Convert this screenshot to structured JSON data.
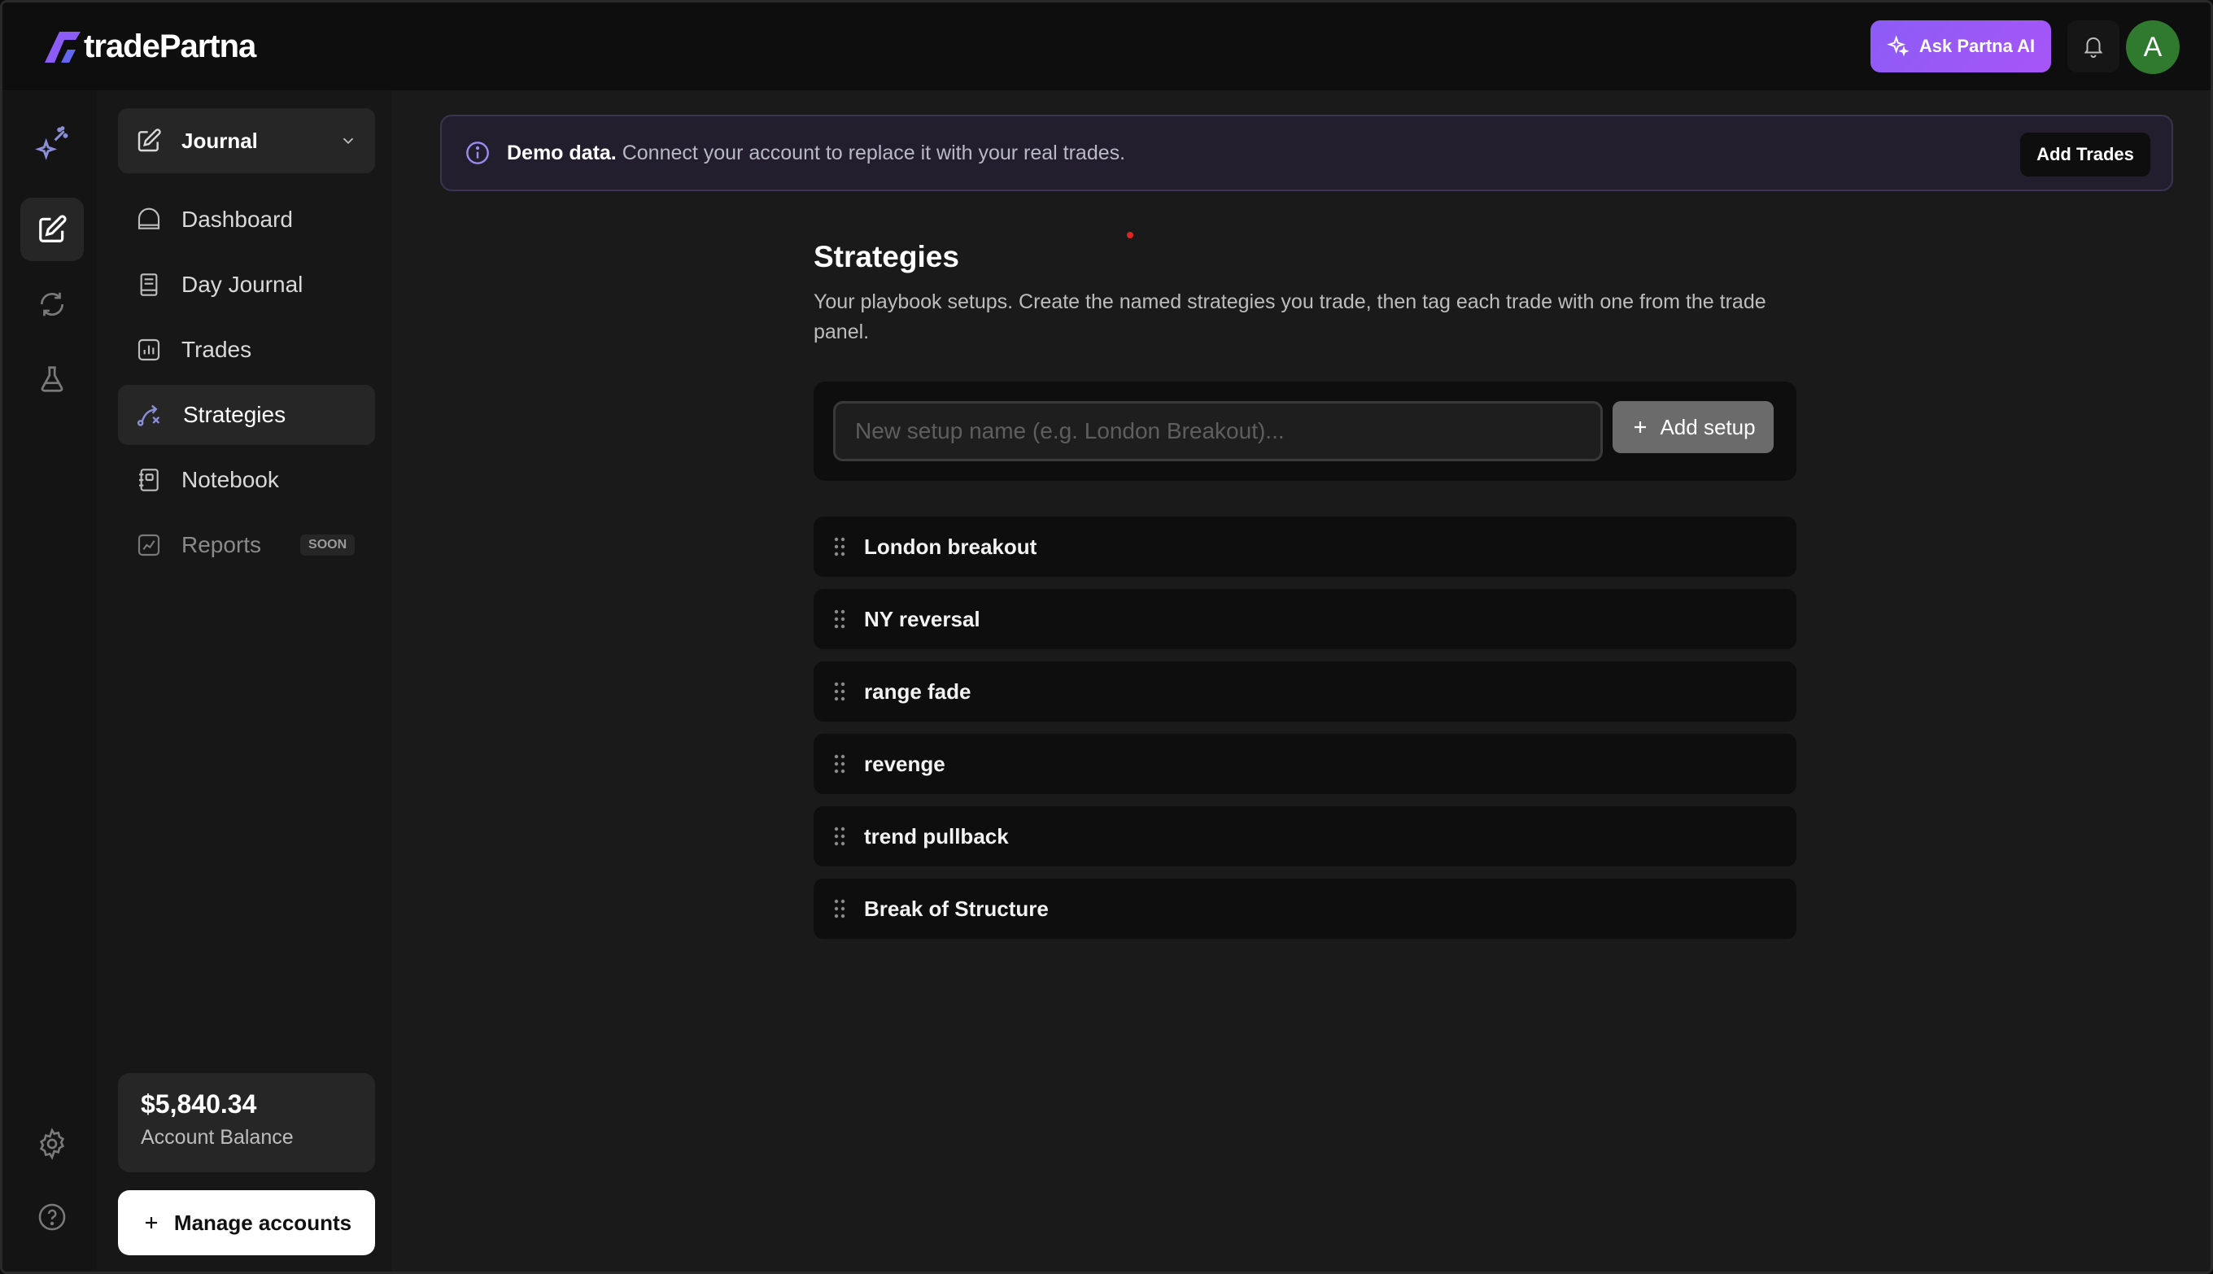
{
  "app": {
    "brand": "tradePartna",
    "brand_color": "#8b5cf6"
  },
  "header": {
    "ask_ai_label": "Ask Partna AI",
    "avatar_initial": "A"
  },
  "rail": {
    "items": [
      {
        "icon": "sparkles-icon"
      },
      {
        "icon": "edit-icon",
        "active": true
      },
      {
        "icon": "refresh-icon"
      },
      {
        "icon": "flask-icon"
      }
    ],
    "bottom": [
      {
        "icon": "gear-icon"
      },
      {
        "icon": "help-icon"
      }
    ]
  },
  "sidebar": {
    "selector_label": "Journal",
    "items": [
      {
        "label": "Dashboard",
        "icon": "home-icon"
      },
      {
        "label": "Day Journal",
        "icon": "book-icon"
      },
      {
        "label": "Trades",
        "icon": "bar-chart-icon"
      },
      {
        "label": "Strategies",
        "icon": "strategy-icon",
        "active": true
      },
      {
        "label": "Notebook",
        "icon": "notebook-icon"
      },
      {
        "label": "Reports",
        "icon": "report-icon",
        "badge": "SOON",
        "disabled": true
      }
    ],
    "balance": {
      "amount": "$5,840.34",
      "label": "Account Balance"
    },
    "manage_label": "Manage accounts"
  },
  "banner": {
    "bold": "Demo data.",
    "text": "Connect your account to replace it with your real trades.",
    "button_label": "Add Trades"
  },
  "page": {
    "title": "Strategies",
    "description": "Your playbook setups. Create the named strategies you trade, then tag each trade with one from the trade panel.",
    "input_placeholder": "New setup name (e.g. London Breakout)...",
    "input_value": "",
    "add_button_label": "Add setup",
    "strategies": [
      "London breakout",
      "NY reversal",
      "range fade",
      "revenge",
      "trend pullback",
      "Break of Structure"
    ]
  }
}
